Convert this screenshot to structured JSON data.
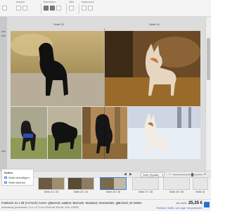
{
  "toolbar": {
    "groups": [
      {
        "label": "Ansicht"
      },
      {
        "label": "Bearbeiten"
      },
      {
        "label": "Hilfe"
      },
      {
        "label": "Impressum"
      }
    ]
  },
  "spread": {
    "left_page_label": "Seite 23",
    "right_page_label": "Seite 24"
  },
  "zoom": {
    "value": "Seite (Spalte)"
  },
  "pages_panel": {
    "title": "Seiten",
    "add_label": "Seite hinzufügen",
    "delete_label": "Seite löschen"
  },
  "thumbnails": [
    {
      "label": "Seite 21 / 22",
      "selected": false
    },
    {
      "label": "Seite 23 / 24",
      "selected": false
    },
    {
      "label": "Seite 25 / 26",
      "selected": true
    },
    {
      "label": "Seite 27 / 28",
      "selected": false
    },
    {
      "label": "Seite 29 / 30",
      "selected": false
    },
    {
      "label": "Seite 31",
      "selected": false
    }
  ],
  "status": {
    "line1": "Fotobuch 21 x 28 (A4 hoch) Cover: glänzend, wattiert, Barcode: Standard, Innenseiten: glänzend, 32 Seiten",
    "line2": "Abmessung (Innenseite): 21,0 x 27,9 cm (Preis bei 300 dpi: 9161 x 8393)",
    "price": "25,35 €",
    "price_note": "inkl. MwSt.",
    "link": "Preisliste, Staffel- und Lager Versandkosten"
  },
  "colors": {
    "accent": "#3b7ddd",
    "toolbar_bg": "#f4f4f4",
    "workspace_bg": "#dcdcdc"
  }
}
